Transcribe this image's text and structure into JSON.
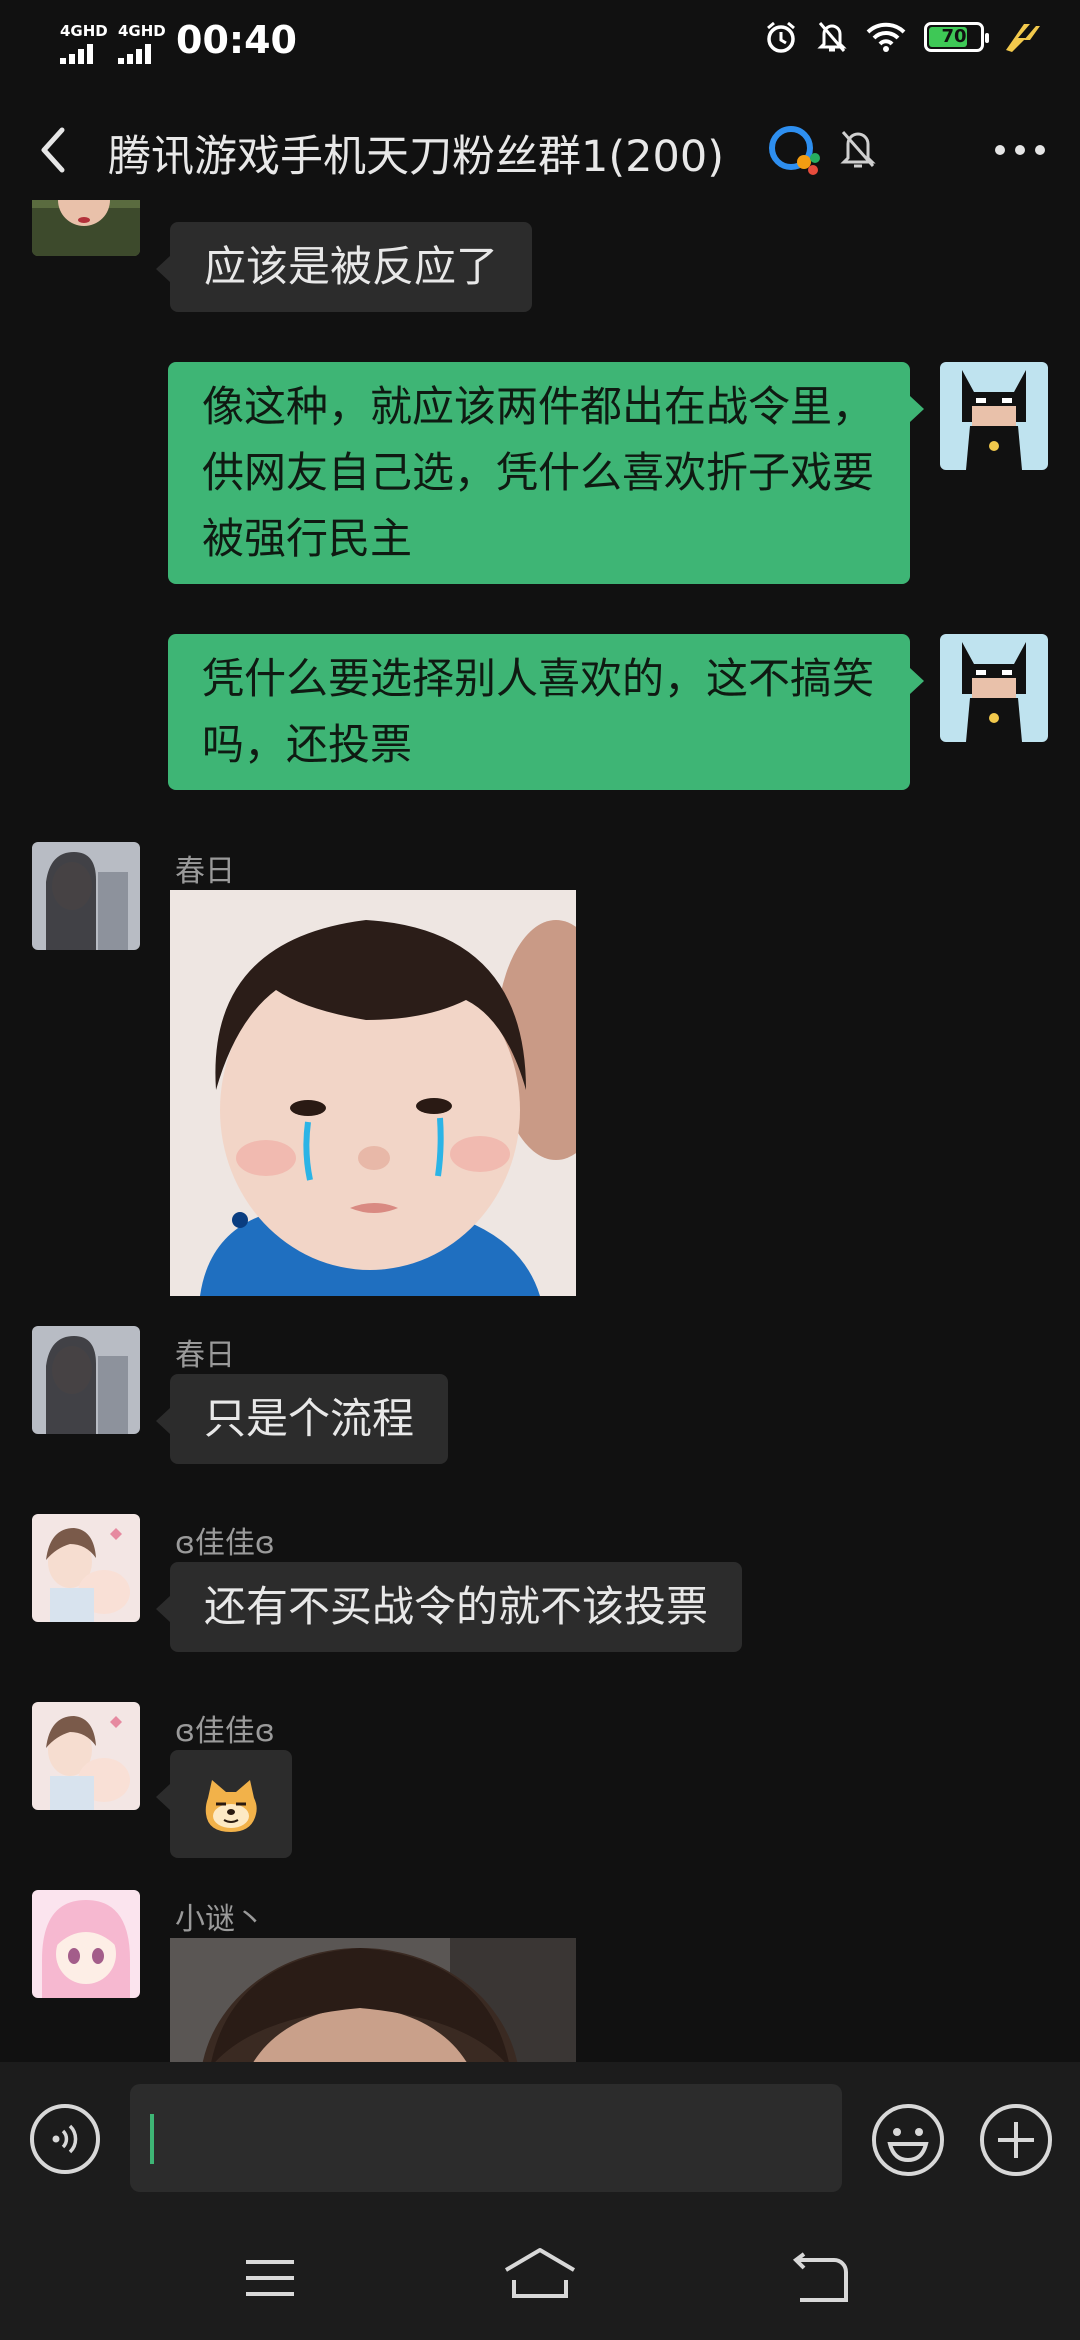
{
  "status": {
    "signal1": "4GHD",
    "signal2": "4GHD",
    "time": "00:40",
    "battery": "70"
  },
  "header": {
    "title": "腾讯游戏手机天刀粉丝群1(200)"
  },
  "messages": [
    {
      "text": "应该是被反应了"
    },
    {
      "text": "像这种，就应该两件都出在战令里，供网友自己选，凭什么喜欢折子戏要被强行民主"
    },
    {
      "text": "凭什么要选择别人喜欢的，这不搞笑吗，还投票"
    },
    {
      "sender": "春日"
    },
    {
      "sender": "春日",
      "text": "只是个流程"
    },
    {
      "sender": "ɞ佳佳ɞ",
      "text": "还有不买战令的就不该投票"
    },
    {
      "sender": "ɞ佳佳ɞ",
      "emoji": "doge-emoji"
    },
    {
      "sender": "小谜丶"
    }
  ],
  "colors": {
    "background": "#111111",
    "bubble_in": "#2c2c2c",
    "bubble_out": "#3eb575",
    "bar": "#1c1c1c"
  }
}
